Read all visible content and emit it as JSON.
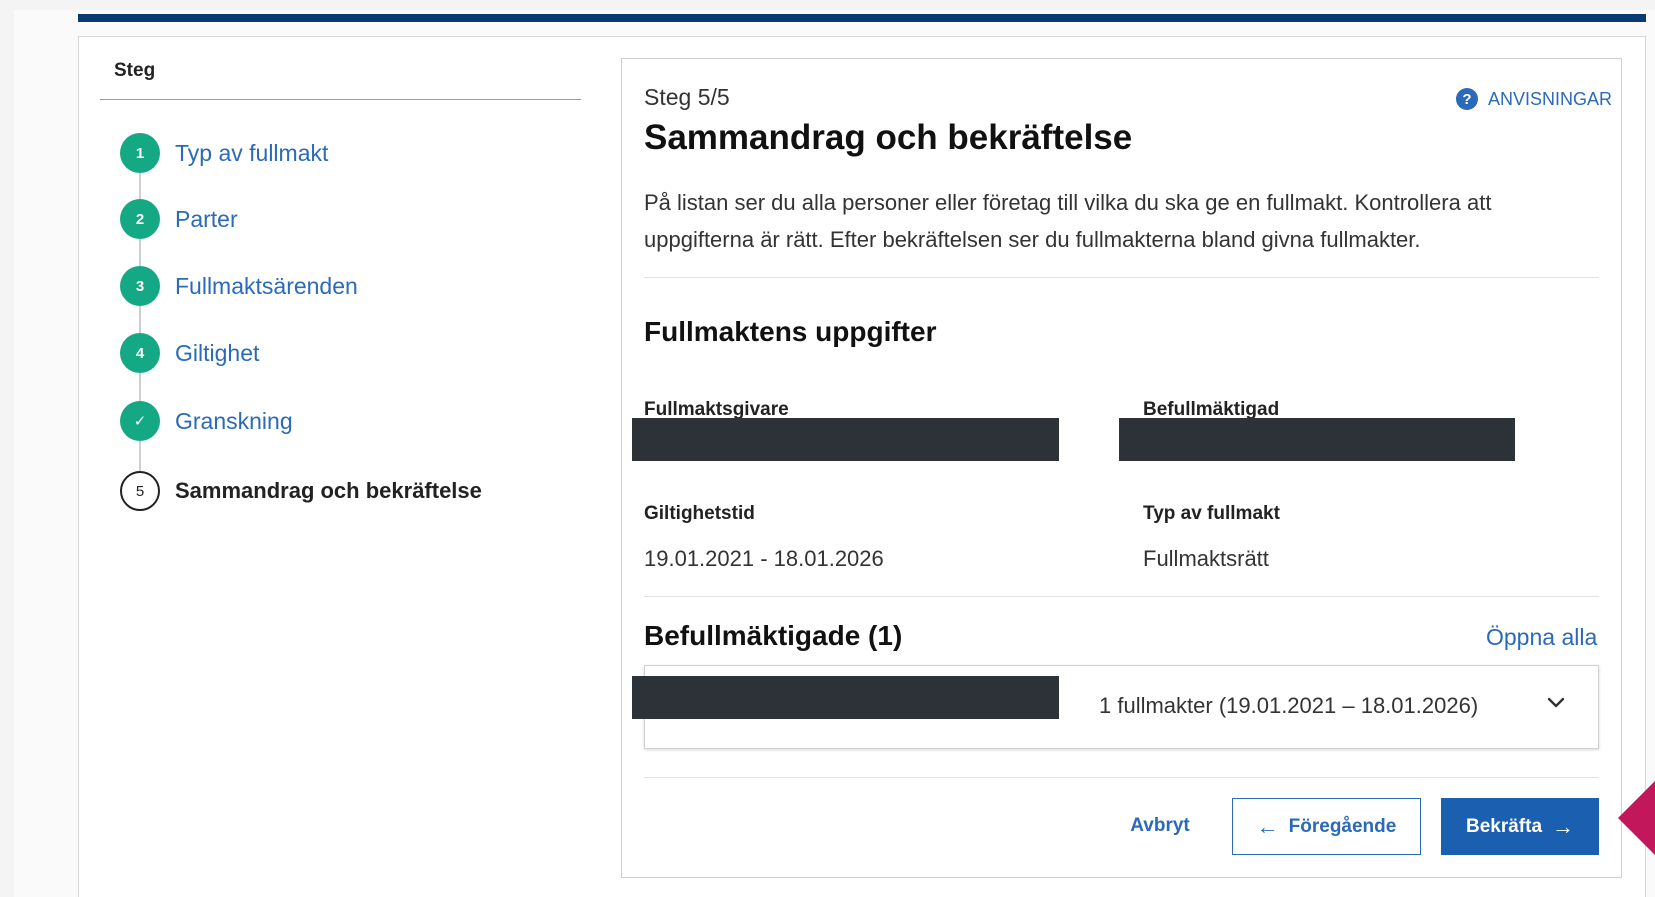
{
  "stepper": {
    "heading": "Steg",
    "steps": [
      {
        "marker": "1",
        "label": "Typ av fullmakt"
      },
      {
        "marker": "2",
        "label": "Parter"
      },
      {
        "marker": "3",
        "label": "Fullmaktsärenden"
      },
      {
        "marker": "4",
        "label": "Giltighet"
      },
      {
        "marker": "✓",
        "label": "Granskning"
      },
      {
        "marker": "5",
        "label": "Sammandrag och bekräftelse"
      }
    ]
  },
  "main": {
    "step_counter": "Steg 5/5",
    "help_label": "ANVISNINGAR",
    "help_icon_glyph": "?",
    "title": "Sammandrag och bekräftelse",
    "intro": "På listan ser du alla personer eller företag till vilka du ska ge en fullmakt. Kontrollera att uppgifterna är rätt. Efter bekräftelsen ser du fullmakterna bland givna fullmakter.",
    "details": {
      "title": "Fullmaktens uppgifter",
      "grantor_label": "Fullmaktsgivare",
      "grantor_value": "",
      "authorized_label": "Befullmäktigad",
      "authorized_value": "",
      "validity_label": "Giltighetstid",
      "validity_value": "19.01.2021 - 18.01.2026",
      "type_label": "Typ av fullmakt",
      "type_value": "Fullmaktsrätt"
    },
    "authorized_list": {
      "title": "Befullmäktigade (1)",
      "open_all": "Öppna alla",
      "rows": [
        {
          "name": "",
          "summary": "1 fullmakter (19.01.2021 – 18.01.2026)"
        }
      ]
    },
    "actions": {
      "cancel": "Avbryt",
      "previous": "Föregående",
      "previous_arrow": "←",
      "confirm": "Bekräfta",
      "confirm_arrow": "→"
    }
  },
  "colors": {
    "brand_bar": "#0b3a73",
    "step_done": "#14a884",
    "link": "#2a6ab8",
    "primary_button": "#1b5fb0",
    "redaction": "#2d3238",
    "pointer": "#c2185b"
  },
  "icons": [
    "help-icon",
    "check-icon",
    "chevron-down-icon",
    "arrow-left-icon",
    "arrow-right-icon"
  ]
}
